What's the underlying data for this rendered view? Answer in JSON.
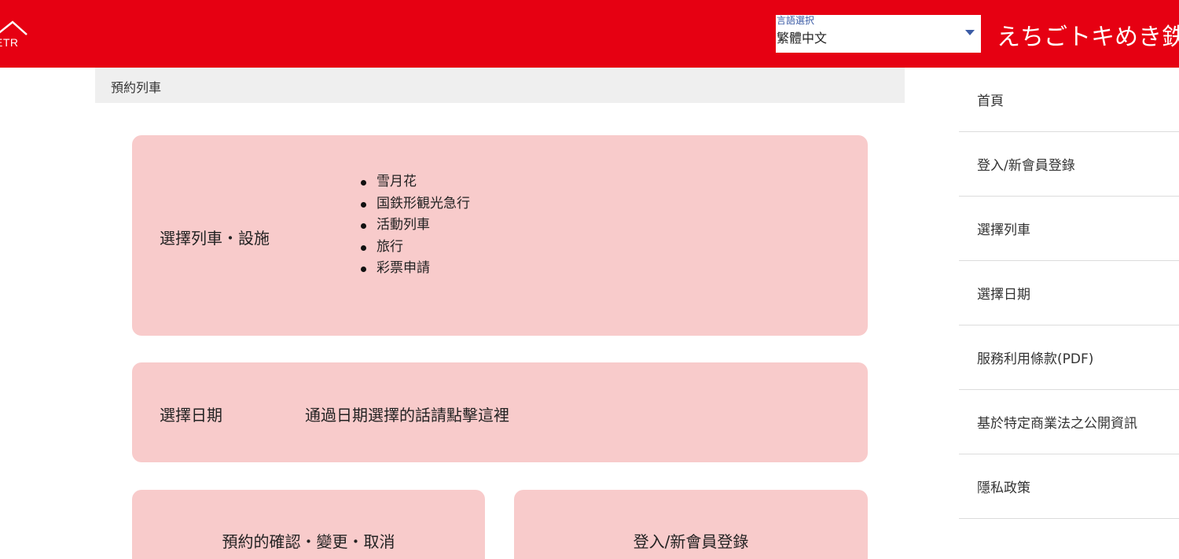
{
  "header": {
    "logo_text": "ETR",
    "language_label": "言語選択",
    "language_value": "繁體中文",
    "brand": "えちごトキめき鉄道"
  },
  "breadcrumb": "預約列車",
  "train_select": {
    "title": "選擇列車・設施",
    "items": [
      "雪月花",
      "国鉄形観光急行",
      "活動列車",
      "旅行",
      "彩票申請"
    ]
  },
  "date_select": {
    "title": "選擇日期",
    "link": "通過日期選擇的話請點擊這裡"
  },
  "reservation_manage": "預約的確認・變更・取消",
  "login_register": "登入/新會員登錄",
  "sidebar": {
    "items": [
      "首頁",
      "登入/新會員登錄",
      "選擇列車",
      "選擇日期",
      "服務利用條款(PDF)",
      "基於特定商業法之公開資訊",
      "隱私政策"
    ]
  },
  "colors": {
    "header_bg": "#e60012",
    "card_bg": "#f8cbcb",
    "breadcrumb_bg": "#efefef",
    "accent": "#3b5ba5"
  }
}
